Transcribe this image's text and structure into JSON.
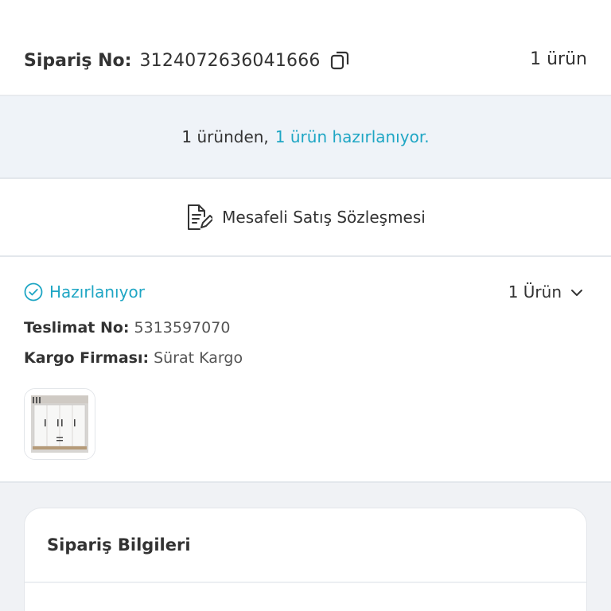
{
  "order": {
    "label": "Sipariş No:",
    "number": "3124072636041666",
    "item_count": "1 ürün"
  },
  "status_band": {
    "prefix": "1 üründen,",
    "highlight": "1 ürün hazırlanıyor."
  },
  "contract": {
    "label": "Mesafeli Satış Sözleşmesi"
  },
  "shipment": {
    "status": "Hazırlanıyor",
    "item_count": "1 Ürün",
    "delivery_label": "Teslimat No:",
    "delivery_no": "5313597070",
    "carrier_label": "Kargo Firması:",
    "carrier_name": "Sürat Kargo"
  },
  "order_info": {
    "title": "Sipariş Bilgileri"
  },
  "colors": {
    "accent": "#1fa6c4",
    "band_bg": "#eff3f8",
    "text": "#333333"
  },
  "icons": {
    "copy": "copy-icon",
    "document": "document-edit-icon",
    "status": "check-circle-icon",
    "expand": "chevron-down-icon"
  }
}
